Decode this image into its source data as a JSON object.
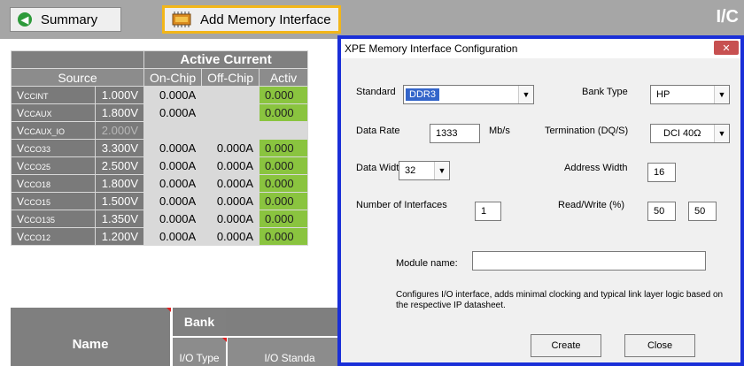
{
  "toolbar": {
    "summary_label": "Summary",
    "add_memory_label": "Add Memory Interface",
    "title_fragment": "I/C"
  },
  "table": {
    "title": "Active Current",
    "col_source": "Source",
    "col_onchip": "On-Chip",
    "col_offchip": "Off-Chip",
    "col_active": "Activ",
    "rows": [
      {
        "name": "V",
        "sub": "CCINT",
        "volt": "1.000V",
        "on": "0.000A",
        "off": "",
        "act": "0.000"
      },
      {
        "name": "V",
        "sub": "CCAUX",
        "volt": "1.800V",
        "on": "0.000A",
        "off": "",
        "act": "0.000"
      },
      {
        "name": "V",
        "sub": "CCAUX_IO",
        "volt": "2.000V",
        "on": "",
        "off": "",
        "act": ""
      },
      {
        "name": "V",
        "sub": "CCO33",
        "volt": "3.300V",
        "on": "0.000A",
        "off": "0.000A",
        "act": "0.000"
      },
      {
        "name": "V",
        "sub": "CCO25",
        "volt": "2.500V",
        "on": "0.000A",
        "off": "0.000A",
        "act": "0.000"
      },
      {
        "name": "V",
        "sub": "CCO18",
        "volt": "1.800V",
        "on": "0.000A",
        "off": "0.000A",
        "act": "0.000"
      },
      {
        "name": "V",
        "sub": "CCO15",
        "volt": "1.500V",
        "on": "0.000A",
        "off": "0.000A",
        "act": "0.000"
      },
      {
        "name": "V",
        "sub": "CCO135",
        "volt": "1.350V",
        "on": "0.000A",
        "off": "0.000A",
        "act": "0.000"
      },
      {
        "name": "V",
        "sub": "CCO12",
        "volt": "1.200V",
        "on": "0.000A",
        "off": "0.000A",
        "act": "0.000"
      }
    ],
    "bank_name_label": "Name",
    "bank_label": "Bank",
    "io_type_label": "I/O Type",
    "io_standard_label": "I/O Standa"
  },
  "dialog": {
    "title": "XPE Memory Interface Configuration",
    "close_glyph": "✕",
    "standard_label": "Standard",
    "standard_value": "DDR3",
    "bank_type_label": "Bank Type",
    "bank_type_value": "HP",
    "data_rate_label": "Data Rate",
    "data_rate_value": "1333",
    "data_rate_unit": "Mb/s",
    "termination_label": "Termination (DQ/S)",
    "termination_value": "DCI 40Ω",
    "data_width_label": "Data Width",
    "data_width_value": "32",
    "address_width_label": "Address Width",
    "address_width_value": "16",
    "num_interfaces_label": "Number of Interfaces",
    "num_interfaces_value": "1",
    "read_write_label": "Read/Write (%)",
    "read_value": "50",
    "write_value": "50",
    "module_name_label": "Module name:",
    "module_name_value": "",
    "description": "Configures I/O interface, adds minimal clocking and typical link layer logic based on the respective IP datasheet.",
    "create_label": "Create",
    "close_label": "Close"
  }
}
